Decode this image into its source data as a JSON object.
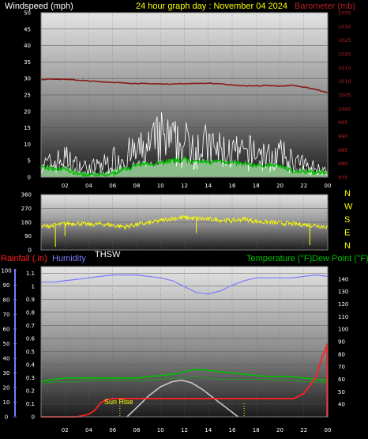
{
  "title": "24 hour graph day : November 04 2024",
  "colors": {
    "wind_label": "#ffffff",
    "title": "#ffff00",
    "barometer": "#8b1a1a",
    "barometer_label": "#b22222",
    "wind_speed": "#ffffff",
    "wind_avg": "#00c000",
    "wind_gust_fill": "#9ed89e",
    "direction": "#ffff00",
    "compass": "#ffff00",
    "thsw": "#ffffff",
    "rainfall": "#ff2020",
    "humidity": "#7a7aff",
    "temperature": "#00c000",
    "dew_point": "#00c000",
    "solar": "#c8c8c8",
    "sunrise": "#ffff00"
  },
  "chart_data": [
    {
      "type": "line",
      "name": "wind-barometer-panel",
      "title": "24 hour graph day : November 04 2024",
      "ylabel_left": "Windspeed (mph)",
      "ylabel_right": "Barometer (mb)",
      "x_ticks": [
        "02",
        "04",
        "06",
        "08",
        "10",
        "12",
        "14",
        "16",
        "18",
        "20",
        "22",
        "00"
      ],
      "y_left_ticks": [
        "0",
        "5",
        "10",
        "15",
        "20",
        "25",
        "30",
        "35",
        "40",
        "45",
        "50"
      ],
      "y_right_ticks": [
        "975",
        "980",
        "985",
        "990",
        "995",
        "1000",
        "1005",
        "1010",
        "1015",
        "1020",
        "1025",
        "1030",
        "1035"
      ],
      "ylim_left": [
        0,
        50
      ],
      "ylim_right": [
        975,
        1035
      ],
      "xlim_hours": [
        0,
        24
      ],
      "series": [
        {
          "name": "Barometer",
          "axis": "right",
          "x": [
            0,
            1,
            2,
            3,
            4,
            5,
            6,
            7,
            8,
            9,
            10,
            11,
            12,
            13,
            14,
            15,
            16,
            17,
            18,
            19,
            20,
            21,
            22,
            23,
            24
          ],
          "values": [
            1010.6,
            1010.8,
            1010.7,
            1010.4,
            1010.1,
            1009.8,
            1009.6,
            1009.3,
            1009.2,
            1009.1,
            1009.0,
            1009.0,
            1009.1,
            1009.2,
            1009.2,
            1009.1,
            1008.6,
            1008.3,
            1008.3,
            1008.4,
            1008.2,
            1008.5,
            1007.9,
            1007.0,
            1005.8
          ]
        },
        {
          "name": "Wind Speed",
          "axis": "left",
          "x": [
            0,
            1,
            2,
            3,
            4,
            5,
            6,
            7,
            8,
            9,
            10,
            11,
            12,
            13,
            14,
            15,
            16,
            17,
            18,
            19,
            20,
            21,
            22,
            23,
            24
          ],
          "values": [
            5,
            6,
            8,
            5,
            4,
            5,
            7,
            9,
            10,
            12,
            16,
            14,
            13,
            15,
            12,
            11,
            10,
            9,
            11,
            8,
            9,
            7,
            5,
            4,
            3
          ]
        },
        {
          "name": "Wind Average",
          "axis": "left",
          "x": [
            0,
            1,
            2,
            3,
            4,
            5,
            6,
            7,
            8,
            9,
            10,
            11,
            12,
            13,
            14,
            15,
            16,
            17,
            18,
            19,
            20,
            21,
            22,
            23,
            24
          ],
          "values": [
            3,
            2.5,
            2.5,
            1,
            0.5,
            0.5,
            1,
            2.5,
            3.5,
            4,
            4.5,
            5,
            5.5,
            4.5,
            4.5,
            5,
            4.5,
            4,
            3.5,
            3.5,
            3.5,
            2,
            1.5,
            1.5,
            1.5
          ]
        }
      ]
    },
    {
      "type": "line",
      "name": "wind-direction-panel",
      "y_ticks": [
        "0",
        "90",
        "180",
        "270",
        "360"
      ],
      "ylim": [
        0,
        360
      ],
      "compass_labels": [
        "N",
        "W",
        "S",
        "E",
        "N"
      ],
      "series": [
        {
          "name": "Wind Direction",
          "x": [
            0,
            1,
            2,
            3,
            4,
            5,
            6,
            7,
            8,
            9,
            10,
            11,
            12,
            13,
            14,
            15,
            16,
            17,
            18,
            19,
            20,
            21,
            22,
            23,
            24
          ],
          "values": [
            150,
            160,
            170,
            175,
            165,
            170,
            160,
            150,
            165,
            175,
            190,
            205,
            210,
            205,
            200,
            195,
            190,
            200,
            185,
            180,
            175,
            170,
            165,
            160,
            150
          ]
        }
      ]
    },
    {
      "type": "line",
      "name": "rain-humidity-temperature-panel",
      "label_thsw": "THSW",
      "ylabel_rain": "Rainfall (.in)",
      "ylabel_humidity": "Humidity",
      "ylabel_temp": "Temperature (°F)",
      "ylabel_dew": "Dew Point (°F)",
      "sunrise_label": "Sun Rise",
      "sunrise_hour": 6.6,
      "sunset_hour": 17.0,
      "x_ticks": [
        "02",
        "04",
        "06",
        "08",
        "10",
        "12",
        "14",
        "16",
        "18",
        "20",
        "22",
        "00"
      ],
      "humidity_ticks": [
        "0",
        "10",
        "20",
        "30",
        "40",
        "50",
        "60",
        "70",
        "80",
        "90",
        "100"
      ],
      "rain_ticks": [
        "0",
        "0.1",
        "0.2",
        "0.3",
        "0.4",
        "0.5",
        "0.6",
        "0.7",
        "0.8",
        "0.9",
        "1",
        "1.1"
      ],
      "temp_ticks": [
        "40",
        "50",
        "60",
        "70",
        "80",
        "90",
        "100",
        "110",
        "120",
        "130",
        "140"
      ],
      "ylim_humidity": [
        0,
        100
      ],
      "ylim_rain": [
        0,
        1.15
      ],
      "ylim_temp": [
        30,
        150
      ],
      "series": [
        {
          "name": "Humidity",
          "x": [
            0,
            1,
            2,
            3,
            4,
            5,
            6,
            7,
            8,
            9,
            10,
            11,
            12,
            13,
            14,
            15,
            16,
            17,
            18,
            19,
            20,
            21,
            22,
            23,
            24
          ],
          "values": [
            92,
            92,
            93,
            94,
            95,
            96,
            97,
            97,
            97,
            96,
            95,
            93,
            89,
            85,
            84,
            86,
            90,
            93,
            95,
            95,
            95,
            95,
            96,
            97,
            96
          ]
        },
        {
          "name": "Temperature",
          "x": [
            0,
            1,
            2,
            3,
            4,
            5,
            6,
            7,
            8,
            9,
            10,
            11,
            12,
            13,
            14,
            15,
            16,
            17,
            18,
            19,
            20,
            21,
            22,
            23,
            24
          ],
          "values": [
            58,
            60,
            61,
            61,
            61,
            61,
            61,
            61,
            61,
            62,
            63,
            64,
            66,
            68,
            67,
            66,
            65,
            64,
            63,
            62,
            62,
            62,
            61,
            60,
            59
          ]
        },
        {
          "name": "Dew Point",
          "x": [
            0,
            1,
            2,
            3,
            4,
            5,
            6,
            7,
            8,
            9,
            10,
            11,
            12,
            13,
            14,
            15,
            16,
            17,
            18,
            19,
            20,
            21,
            22,
            23,
            24
          ],
          "values": [
            56,
            58,
            58,
            58,
            59,
            59,
            59,
            59,
            59,
            59,
            60,
            61,
            61,
            62,
            61,
            60,
            60,
            60,
            60,
            60,
            59,
            59,
            58,
            58,
            57
          ]
        },
        {
          "name": "Rainfall",
          "x": [
            0,
            1,
            2,
            3,
            4,
            4.5,
            5,
            5.5,
            6,
            7,
            8,
            10,
            12,
            14,
            16,
            18,
            20,
            21.2,
            22,
            22.5,
            23,
            23.5,
            24
          ],
          "values": [
            0,
            0,
            0,
            0,
            0.02,
            0.05,
            0.11,
            0.13,
            0.14,
            0.14,
            0.14,
            0.14,
            0.14,
            0.14,
            0.14,
            0.14,
            0.14,
            0.14,
            0.18,
            0.24,
            0.3,
            0.45,
            0.56
          ]
        },
        {
          "name": "Solar",
          "x": [
            7.2,
            8,
            9,
            10,
            11,
            11.8,
            12.6,
            13.5,
            14.5,
            15.5,
            16.5
          ],
          "values": [
            0,
            0.07,
            0.16,
            0.23,
            0.27,
            0.28,
            0.26,
            0.21,
            0.14,
            0.07,
            0
          ]
        }
      ]
    }
  ]
}
